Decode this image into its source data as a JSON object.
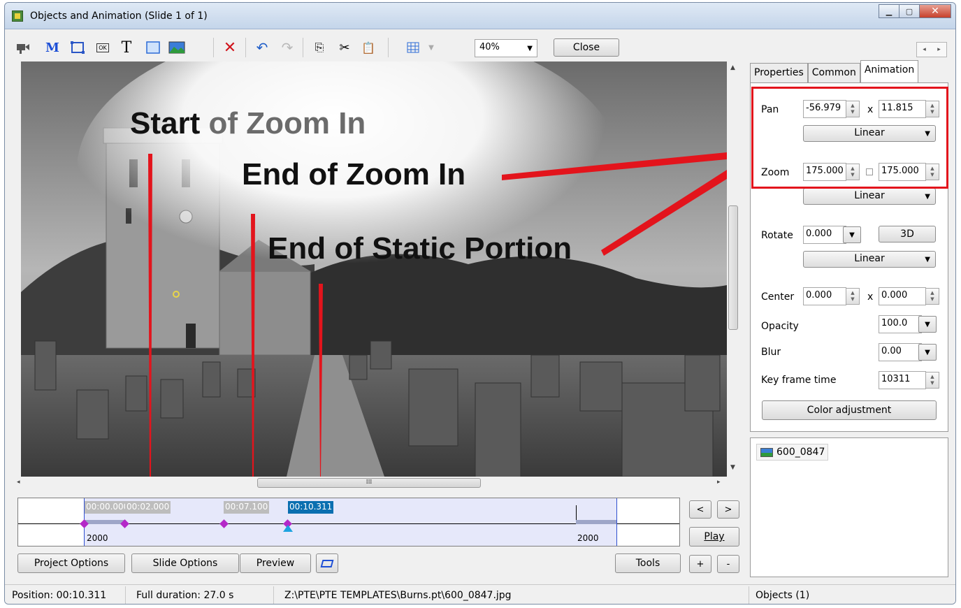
{
  "window": {
    "title": "Objects and Animation  (Slide 1 of 1)"
  },
  "toolbar": {
    "zoom_value": "40%",
    "close_label": "Close",
    "m_glyph": "M",
    "t_glyph": "T",
    "ok_glyph": "OK"
  },
  "annotations": {
    "start_zoom_in": "Start of Zoom In",
    "start_part1": "Start",
    "start_part2": " of Zoom In",
    "end_zoom_in": "End of Zoom In",
    "end_static": "End of Static Portion"
  },
  "timeline": {
    "markers": [
      "00:00.000",
      "00:02.000",
      "00:07.100",
      "00:10.311"
    ],
    "left_value": "2000",
    "right_value": "2000"
  },
  "buttons": {
    "project_options": "Project Options",
    "slide_options": "Slide Options",
    "preview": "Preview",
    "tools": "Tools",
    "play": "Play",
    "prev": "<",
    "next": ">",
    "plus": "+",
    "minus": "-",
    "threed": "3D",
    "color_adjustment": "Color adjustment"
  },
  "tabs": [
    "Properties",
    "Common",
    "Animation"
  ],
  "animation": {
    "pan_label": "Pan",
    "pan_x": "-56.979",
    "pan_y": "11.815",
    "pan_mode": "Linear",
    "zoom_label": "Zoom",
    "zoom_x": "175.000",
    "zoom_y": "175.000",
    "zoom_mode": "Linear",
    "rotate_label": "Rotate",
    "rotate_value": "0.000",
    "rotate_mode": "Linear",
    "center_label": "Center",
    "center_x": "0.000",
    "center_y": "0.000",
    "opacity_label": "Opacity",
    "opacity_value": "100.0",
    "blur_label": "Blur",
    "blur_value": "0.00",
    "keyframe_label": "Key frame time",
    "keyframe_value": "10311",
    "x_sep": "x"
  },
  "objects": {
    "item": "600_0847"
  },
  "status": {
    "position": "Position: 00:10.311",
    "duration": "Full duration:  27.0 s",
    "path": "Z:\\PTE\\PTE TEMPLATES\\Burns.pt\\600_0847.jpg",
    "objects": "Objects (1)"
  },
  "colors": {
    "annotation_red": "#e3141c",
    "timeline_active": "#0a6fb0",
    "keyframe": "#b428c8"
  }
}
